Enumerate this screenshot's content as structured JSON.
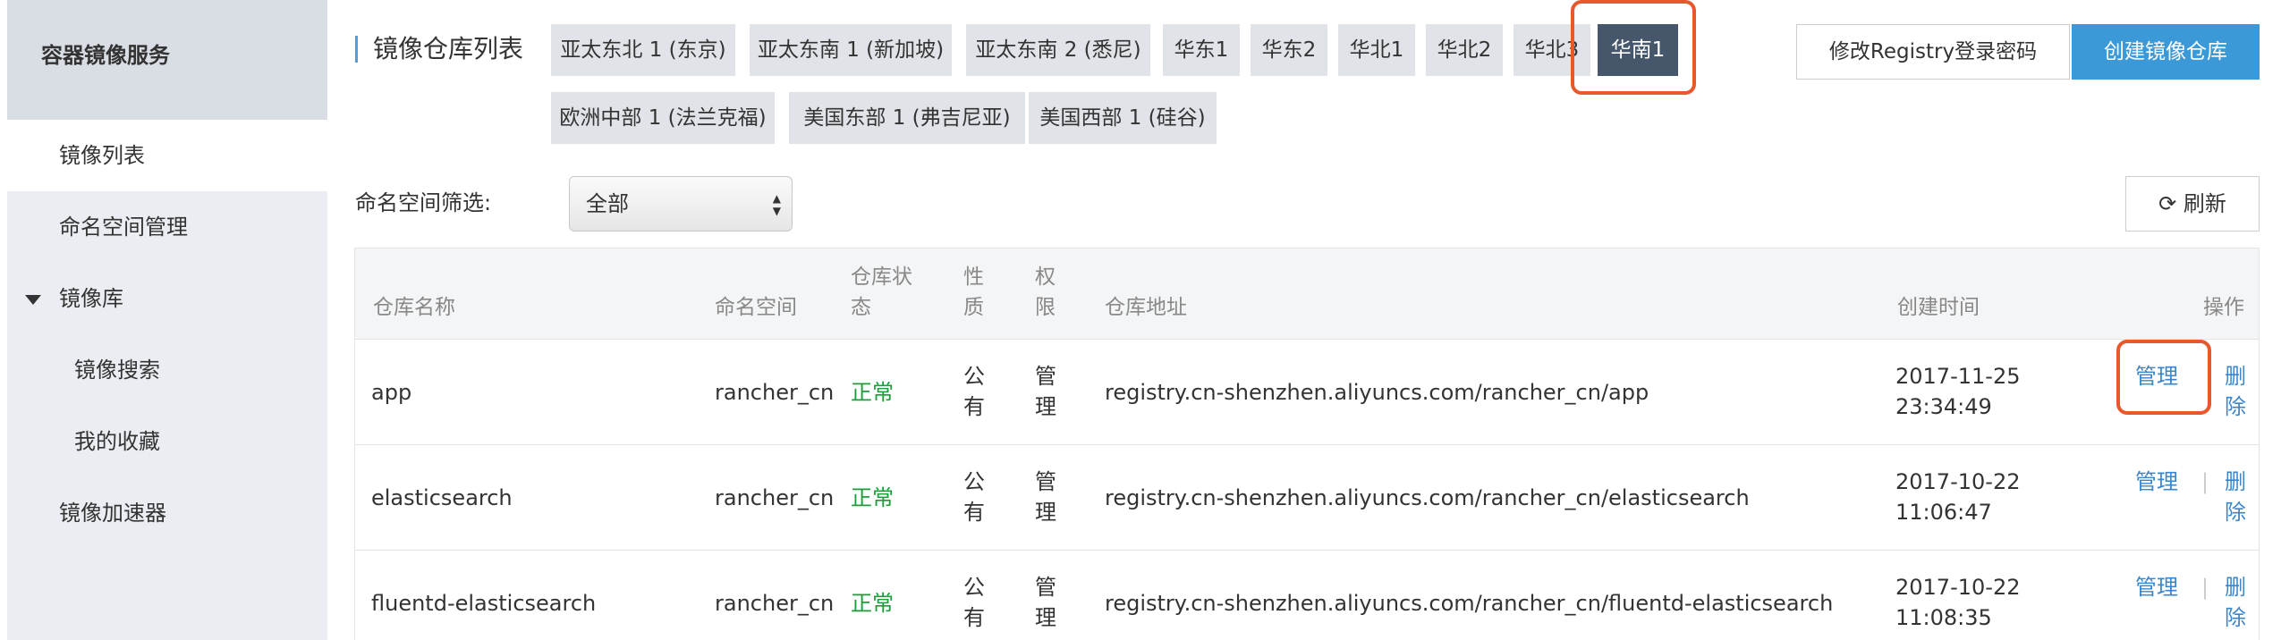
{
  "sidebar": {
    "title": "容器镜像服务",
    "items": [
      {
        "label": "镜像列表"
      },
      {
        "label": "命名空间管理"
      },
      {
        "label": "镜像库"
      },
      {
        "label": "镜像搜索"
      },
      {
        "label": "我的收藏"
      },
      {
        "label": "镜像加速器"
      }
    ]
  },
  "header": {
    "title": "镜像仓库列表",
    "regions": [
      "亚太东北 1 (东京)",
      "亚太东南 1 (新加坡)",
      "亚太东南 2 (悉尼)",
      "华东1",
      "华东2",
      "华北1",
      "华北2",
      "华北3",
      "华南1",
      "欧洲中部 1 (法兰克福)",
      "美国东部 1 (弗吉尼亚)",
      "美国西部 1 (硅谷)"
    ],
    "active_region": "华南1",
    "registry_password_label": "修改Registry登录密码",
    "create_repo_label": "创建镜像仓库"
  },
  "filter": {
    "namespace_label": "命名空间筛选:",
    "namespace_value": "全部",
    "refresh_label": "刷新"
  },
  "table": {
    "headers": {
      "name": "仓库名称",
      "namespace": "命名空间",
      "status_1": "仓库状",
      "status_2": "态",
      "nature_1": "性",
      "nature_2": "质",
      "perm_1": "权",
      "perm_2": "限",
      "address": "仓库地址",
      "created": "创建时间",
      "ops": "操作"
    },
    "rows": [
      {
        "name": "app",
        "namespace": "rancher_cn",
        "status": "正常",
        "nature_1": "公",
        "nature_2": "有",
        "perm_1": "管",
        "perm_2": "理",
        "address": "registry.cn-shenzhen.aliyuncs.com/rancher_cn/app",
        "date": "2017-11-25",
        "time": "23:34:49",
        "manage": "管理",
        "delete_1": "删",
        "delete_2": "除"
      },
      {
        "name": "elasticsearch",
        "namespace": "rancher_cn",
        "status": "正常",
        "nature_1": "公",
        "nature_2": "有",
        "perm_1": "管",
        "perm_2": "理",
        "address": "registry.cn-shenzhen.aliyuncs.com/rancher_cn/elasticsearch",
        "date": "2017-10-22",
        "time": "11:06:47",
        "manage": "管理",
        "delete_1": "删",
        "delete_2": "除"
      },
      {
        "name": "fluentd-elasticsearch",
        "namespace": "rancher_cn",
        "status": "正常",
        "nature_1": "公",
        "nature_2": "有",
        "perm_1": "管",
        "perm_2": "理",
        "address": "registry.cn-shenzhen.aliyuncs.com/rancher_cn/fluentd-elasticsearch",
        "date": "2017-10-22",
        "time": "11:08:35",
        "manage": "管理",
        "delete_1": "删",
        "delete_2": "除"
      }
    ]
  },
  "colors": {
    "accent": "#3c99d8",
    "active_region": "#46576b",
    "status_ok": "#1a9e3a",
    "link": "#3a86cd",
    "highlight": "#e8582d"
  }
}
